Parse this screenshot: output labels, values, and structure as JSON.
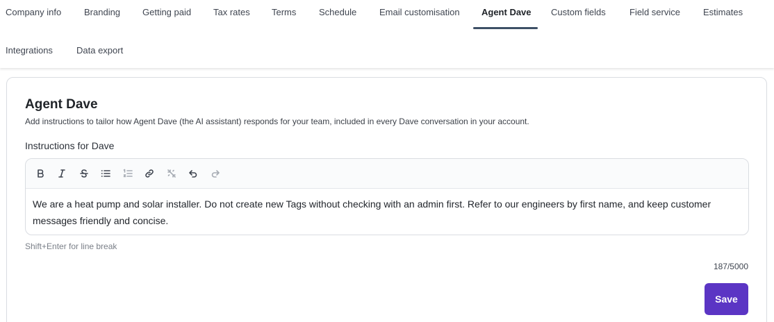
{
  "tabs": [
    {
      "label": "Company info",
      "active": false
    },
    {
      "label": "Branding",
      "active": false
    },
    {
      "label": "Getting paid",
      "active": false
    },
    {
      "label": "Tax rates",
      "active": false
    },
    {
      "label": "Terms",
      "active": false
    },
    {
      "label": "Schedule",
      "active": false
    },
    {
      "label": "Email customisation",
      "active": false
    },
    {
      "label": "Agent Dave",
      "active": true
    },
    {
      "label": "Custom fields",
      "active": false
    },
    {
      "label": "Field service",
      "active": false
    },
    {
      "label": "Estimates",
      "active": false
    },
    {
      "label": "Integrations",
      "active": false
    },
    {
      "label": "Data export",
      "active": false
    }
  ],
  "panel": {
    "title": "Agent Dave",
    "description": "Add instructions to tailor how Agent Dave (the AI assistant) responds for your team, included in every Dave conversation in your account.",
    "field_label": "Instructions for Dave",
    "toolbar_icons": [
      "bold-icon",
      "italic-icon",
      "strikethrough-icon",
      "bullet-list-icon",
      "numbered-list-icon",
      "link-icon",
      "unlink-icon",
      "undo-icon",
      "redo-icon"
    ],
    "instructions_value": "We are a heat pump and solar installer. Do not create new Tags without checking with an admin first. Refer to our engineers by first name, and keep customer messages friendly and concise.",
    "hint": "Shift+Enter for line break",
    "counter": "187/5000",
    "save_label": "Save"
  },
  "colors": {
    "accent": "#5b35c4",
    "tab_underline": "#3e5066",
    "border": "#d9dce1"
  }
}
